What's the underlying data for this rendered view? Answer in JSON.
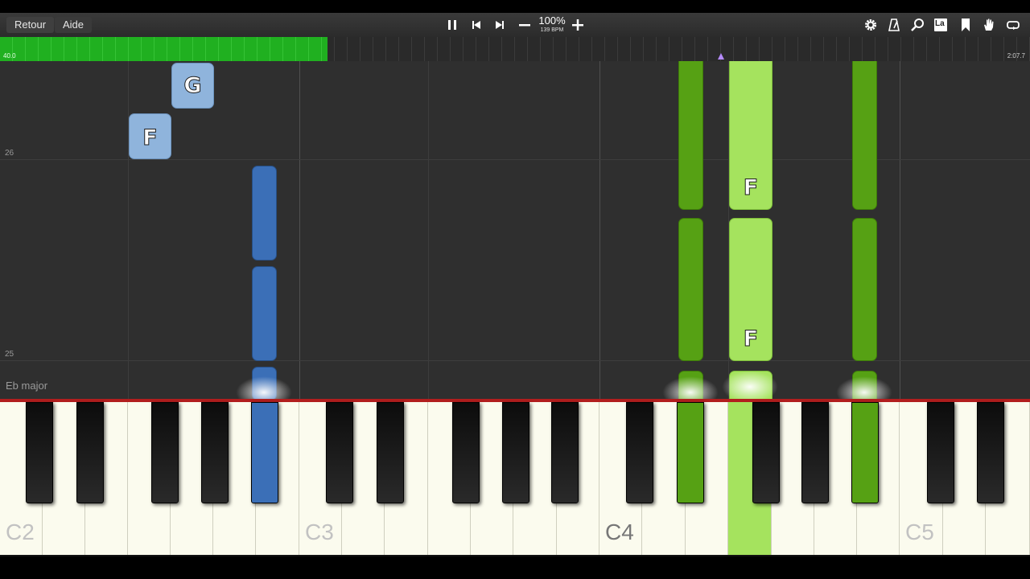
{
  "toolbar": {
    "back_label": "Retour",
    "help_label": "Aide",
    "speed_percent": "100%",
    "speed_bpm": "139 BPM",
    "icons": [
      "pause-icon",
      "skip-back-icon",
      "skip-forward-icon",
      "minus-icon",
      "plus-icon",
      "gear-icon",
      "metronome-icon",
      "magnifier-icon",
      "label-icon",
      "bookmark-icon",
      "hand-icon",
      "loop-icon"
    ],
    "label_icon_text": "La"
  },
  "progress": {
    "position_left": "40.0",
    "position_right": "2:07.7",
    "fill_fraction": 0.318
  },
  "roll": {
    "measure_top": "26",
    "measure_bottom": "25",
    "key_signature": "Eb major"
  },
  "notes": {
    "upper_g": "G",
    "upper_f": "F",
    "green_f1": "F",
    "green_f2": "F"
  },
  "keyboard": {
    "labels": [
      "C2",
      "C3",
      "C4",
      "C5"
    ]
  },
  "colors": {
    "left_hand": "#3b6fb7",
    "left_hand_light": "#8fb4dc",
    "right_hand_dark": "#56a114",
    "right_hand_light": "#a5e35e",
    "progress": "#20b020",
    "hit_line": "#b21e1e"
  }
}
